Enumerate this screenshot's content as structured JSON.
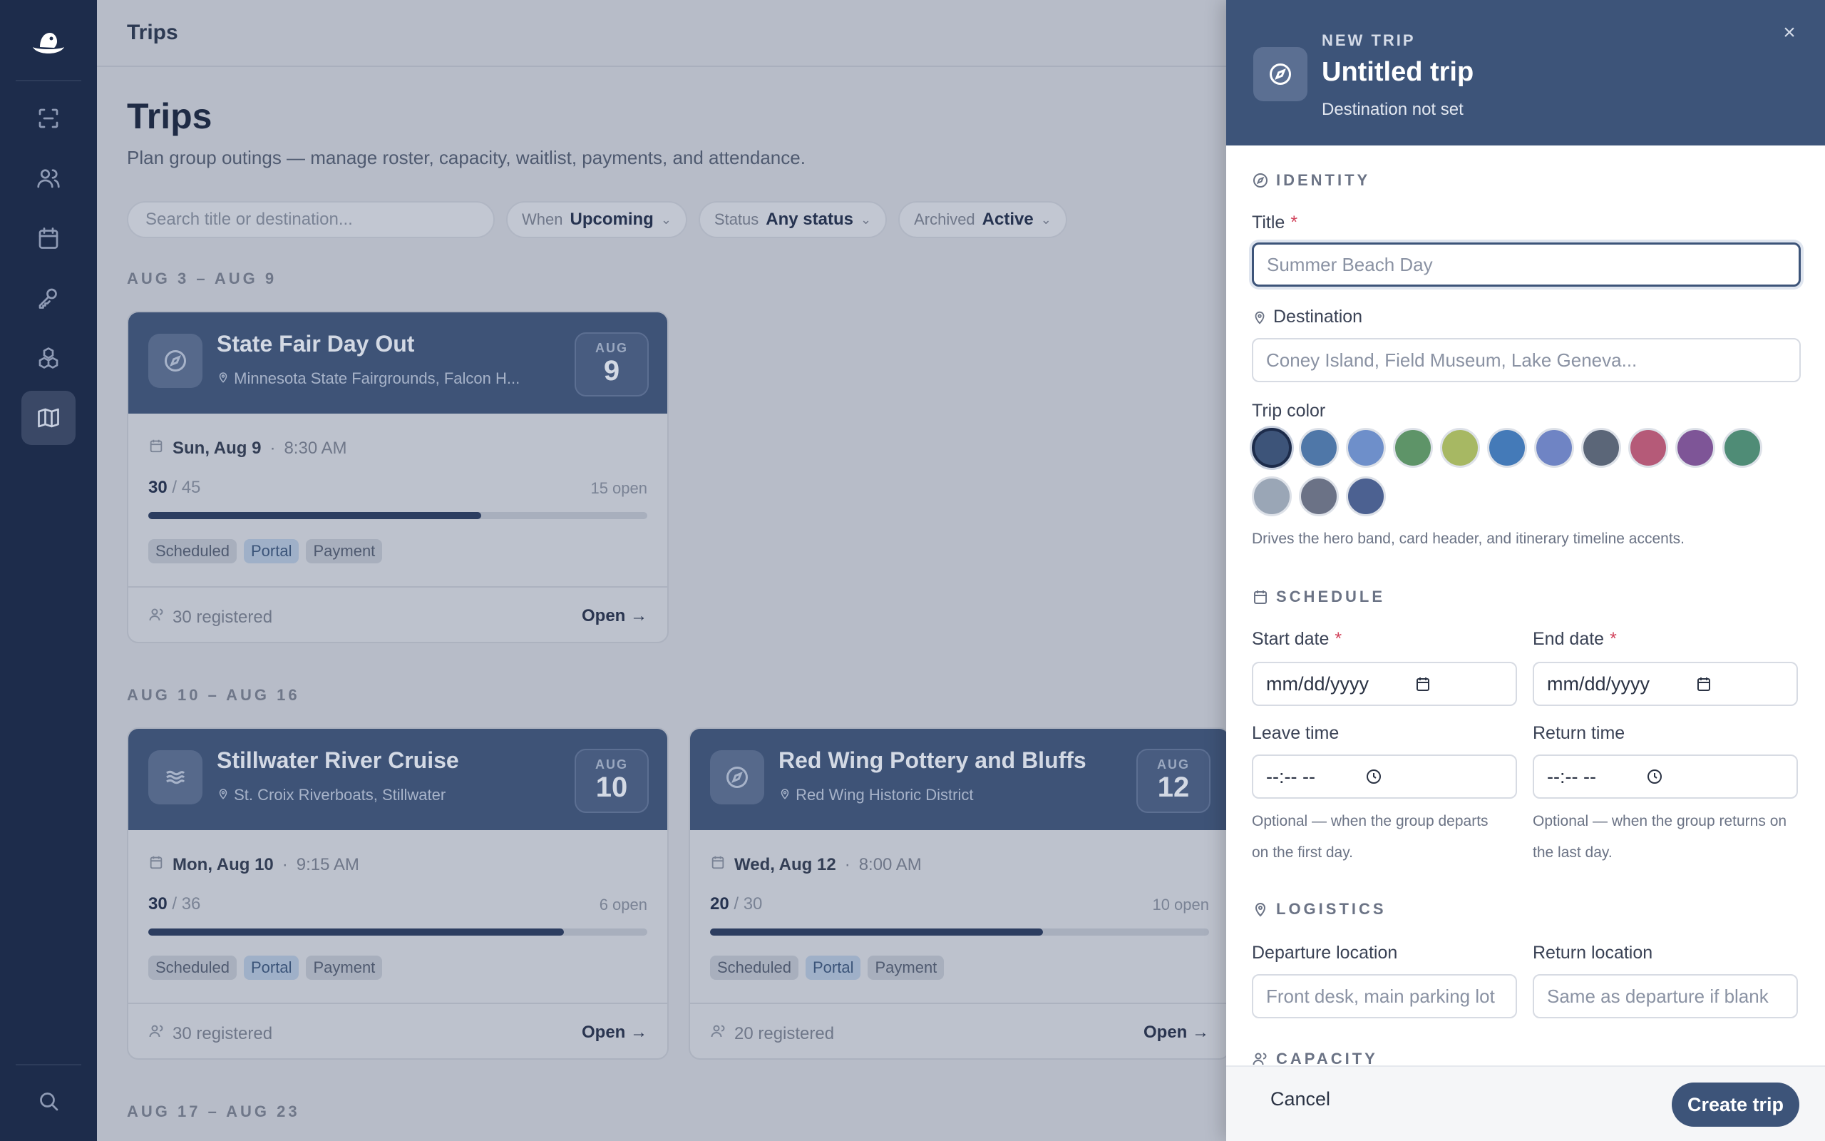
{
  "sidebar": {
    "items": [
      {
        "icon": "scan-icon"
      },
      {
        "icon": "users-icon"
      },
      {
        "icon": "calendar-icon"
      },
      {
        "icon": "key-icon"
      },
      {
        "icon": "boxes-icon"
      },
      {
        "icon": "map-icon"
      }
    ],
    "bottom_icon": "search-icon"
  },
  "topbar": {
    "title": "Trips"
  },
  "page": {
    "title": "Trips",
    "subtitle": "Plan group outings — manage roster, capacity, waitlist, payments, and attendance."
  },
  "filters": {
    "search_placeholder": "Search title or destination...",
    "when": {
      "label": "When",
      "value": "Upcoming"
    },
    "status": {
      "label": "Status",
      "value": "Any status"
    },
    "archived": {
      "label": "Archived",
      "value": "Active"
    }
  },
  "weeks": [
    "AUG 3 – AUG 9",
    "AUG 10 – AUG 16",
    "AUG 17 – AUG 23"
  ],
  "cards": [
    {
      "title": "State Fair Day Out",
      "location": "Minnesota State Fairgrounds, Falcon H...",
      "month": "AUG",
      "day": "9",
      "date": "Sun, Aug 9",
      "time": "8:30 AM",
      "registered": "30",
      "capacity": "/ 45",
      "open": "15 open",
      "fill": 0.667,
      "tags": [
        "Scheduled",
        "Portal",
        "Payment"
      ],
      "registered_text": "30 registered",
      "open_link": "Open"
    },
    {
      "title": "Stillwater River Cruise",
      "location": "St. Croix Riverboats, Stillwater",
      "month": "AUG",
      "day": "10",
      "date": "Mon, Aug 10",
      "time": "9:15 AM",
      "registered": "30",
      "capacity": "/ 36",
      "open": "6 open",
      "fill": 0.833,
      "tags": [
        "Scheduled",
        "Portal",
        "Payment"
      ],
      "registered_text": "30 registered",
      "open_link": "Open"
    },
    {
      "title": "Red Wing Pottery and Bluffs",
      "location": "Red Wing Historic District",
      "month": "AUG",
      "day": "12",
      "date": "Wed, Aug 12",
      "time": "8:00 AM",
      "registered": "20",
      "capacity": "/ 30",
      "open": "10 open",
      "fill": 0.667,
      "tags": [
        "Scheduled",
        "Portal",
        "Payment"
      ],
      "registered_text": "20 registered",
      "open_link": "Open"
    }
  ],
  "drawer": {
    "kicker": "NEW TRIP",
    "title": "Untitled trip",
    "subtitle": "Destination not set",
    "close": "×",
    "sections": {
      "identity": "IDENTITY",
      "schedule": "SCHEDULE",
      "logistics": "LOGISTICS",
      "capacity": "CAPACITY"
    },
    "title_label": "Title",
    "title_placeholder": "Summer Beach Day",
    "destination_label": "Destination",
    "destination_placeholder": "Coney Island, Field Museum, Lake Geneva...",
    "color_label": "Trip color",
    "colors": [
      "#3d5479",
      "#4f77a8",
      "#6e8fca",
      "#5e9468",
      "#a7b863",
      "#447ab8",
      "#6f84c4",
      "#5b6678",
      "#b55a78",
      "#7e5597",
      "#4f8c76",
      "#9aa6b6",
      "#6b7286",
      "#4c6191"
    ],
    "selected_color": 0,
    "color_help": "Drives the hero band, card header, and itinerary timeline accents.",
    "start_label": "Start date",
    "end_label": "End date",
    "date_value": "mm/dd/yyyy",
    "leave_label": "Leave time",
    "return_label": "Return time",
    "time_value": "--:-- --",
    "leave_help": "Optional — when the group departs on the first day.",
    "return_help": "Optional — when the group returns on the last day.",
    "departure_label": "Departure location",
    "departure_placeholder": "Front desk, main parking lot",
    "return_loc_label": "Return location",
    "return_loc_placeholder": "Same as departure if blank",
    "cancel": "Cancel",
    "create": "Create trip"
  }
}
